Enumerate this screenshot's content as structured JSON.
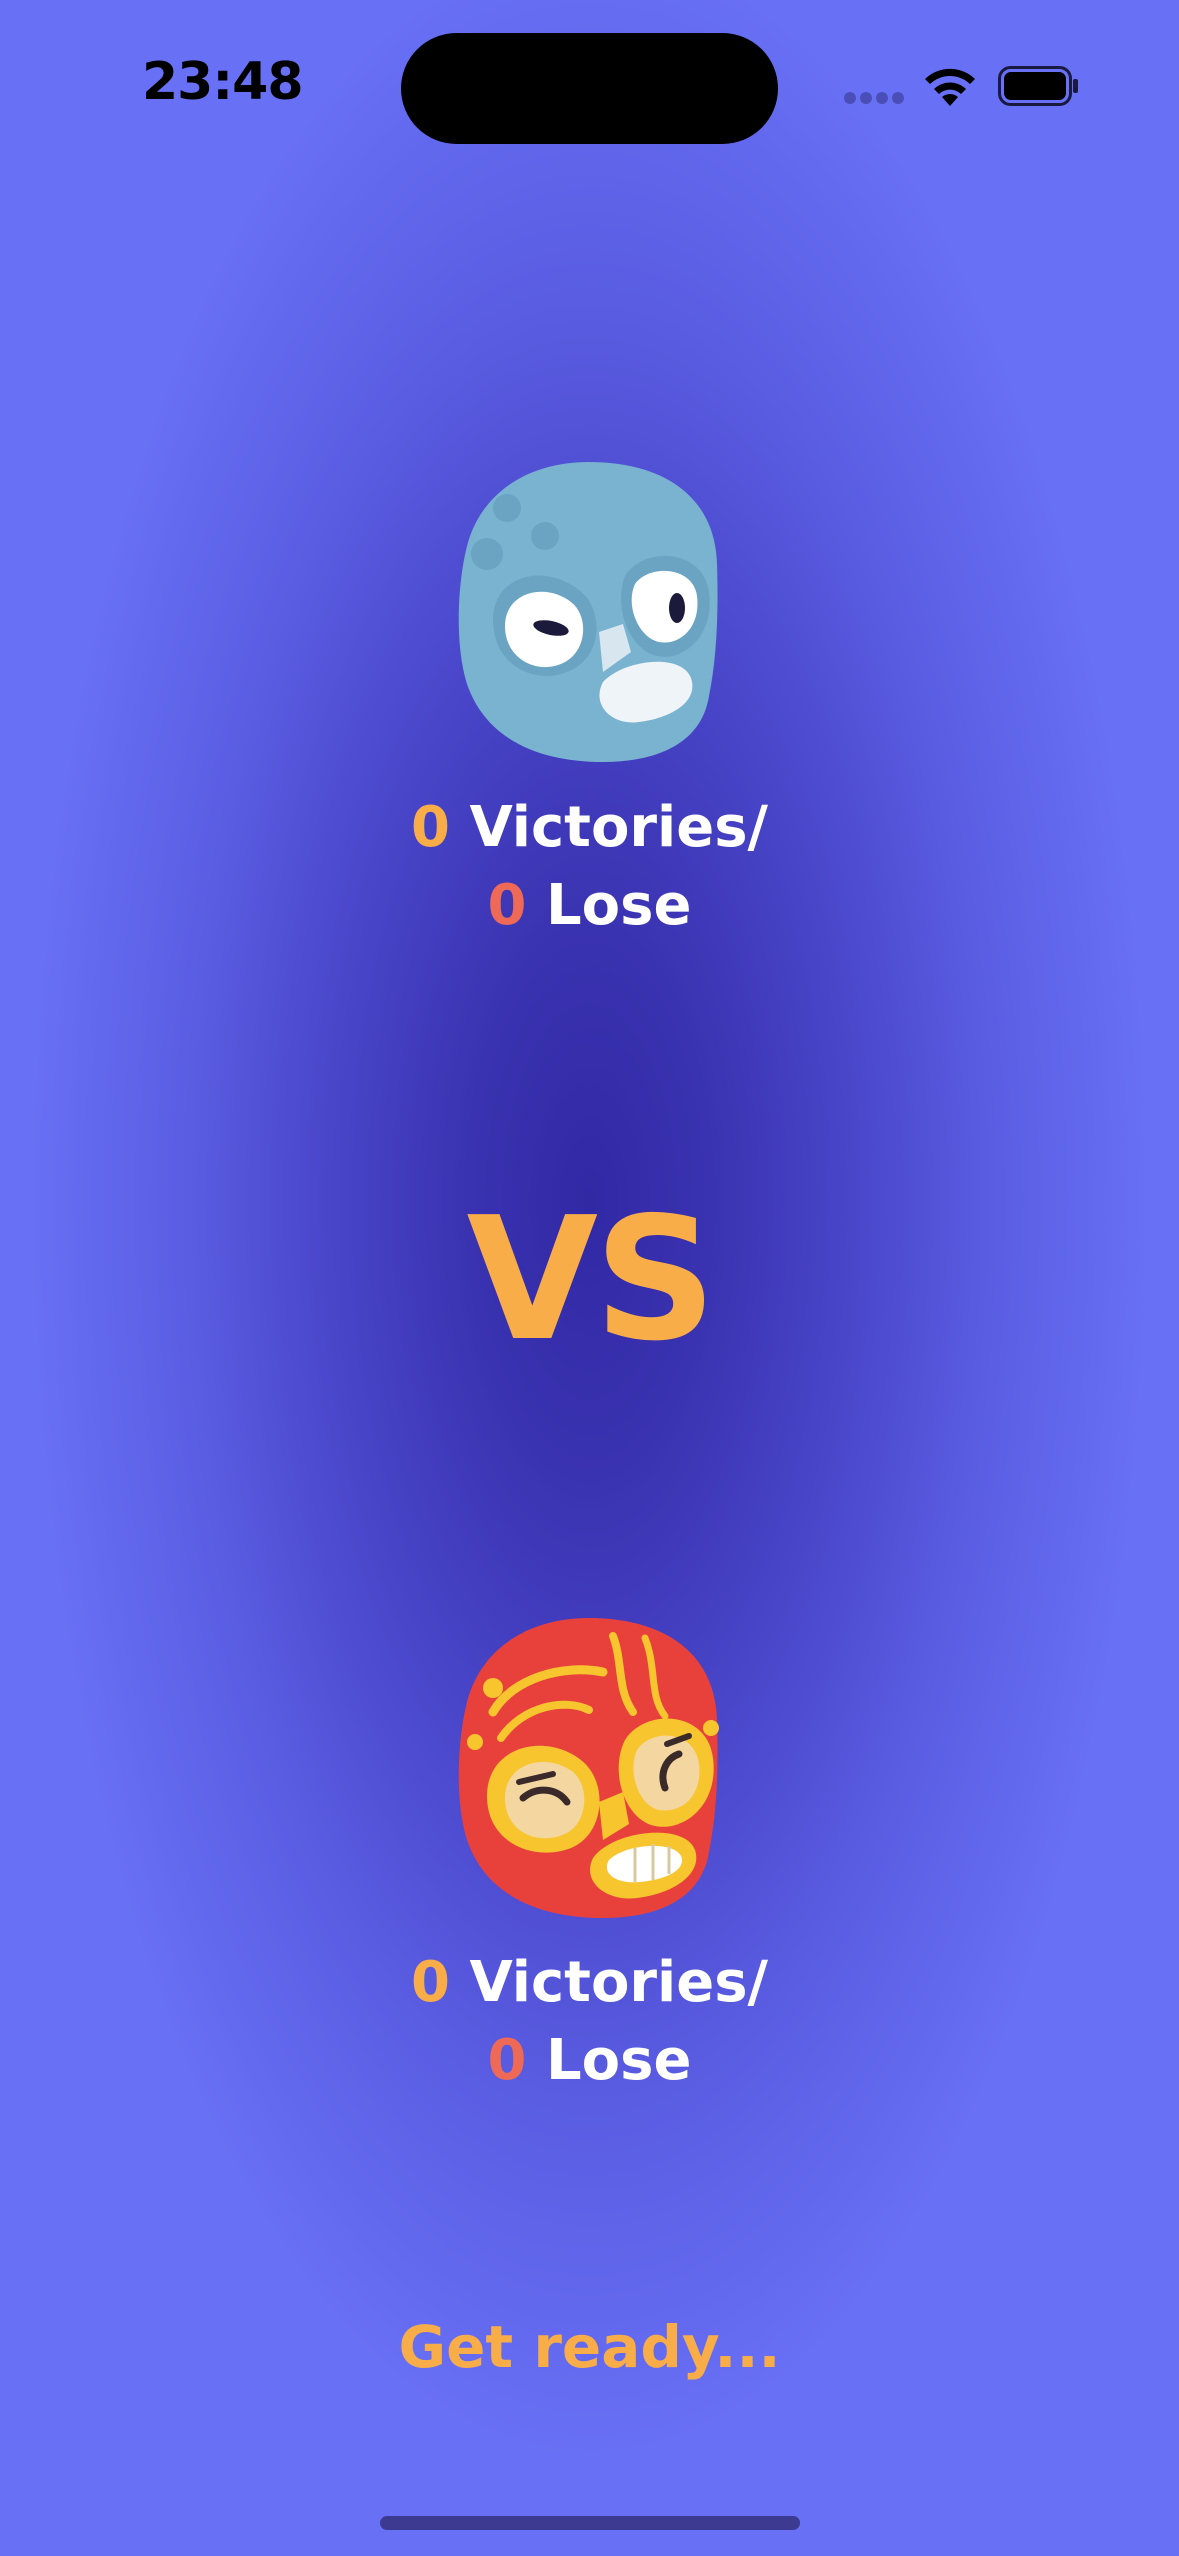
{
  "status_bar": {
    "time": "23:48"
  },
  "players": [
    {
      "avatar_icon": "blue-wrestler-mask-icon",
      "victories": "0",
      "victories_label": "Victories/",
      "losses": "0",
      "losses_label": "Lose"
    },
    {
      "avatar_icon": "red-wrestler-mask-icon",
      "victories": "0",
      "victories_label": "Victories/",
      "losses": "0",
      "losses_label": "Lose"
    }
  ],
  "versus_label": "VS",
  "status_message": "Get ready...",
  "colors": {
    "accent": "#f8ad48",
    "lose": "#ee6a56",
    "text": "#ffffff",
    "background_center": "#3128a4",
    "background_edge": "#6870f5"
  }
}
